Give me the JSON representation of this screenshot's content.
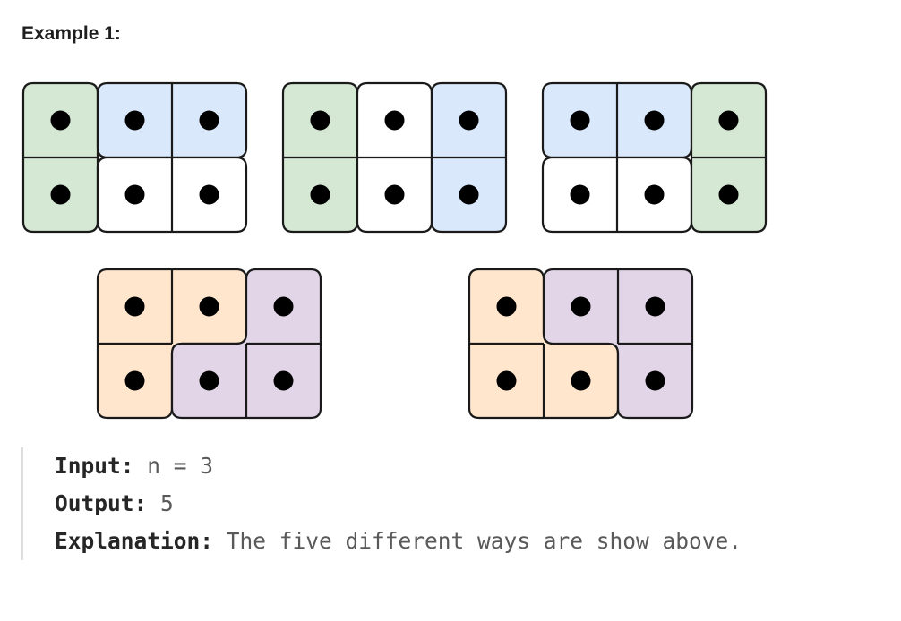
{
  "heading": "Example 1:",
  "colors": {
    "green": "#d5e8d4",
    "blue": "#dae8fc",
    "white": "#ffffff",
    "orange": "#ffe6cc",
    "purple": "#e1d5e7",
    "stroke": "#1a1a1a",
    "dot": "#000000"
  },
  "tilings": [
    {
      "pieces": [
        {
          "cells": [
            [
              0,
              0
            ],
            [
              1,
              0
            ]
          ],
          "color": "green"
        },
        {
          "cells": [
            [
              0,
              1
            ],
            [
              0,
              2
            ]
          ],
          "color": "blue"
        },
        {
          "cells": [
            [
              1,
              1
            ],
            [
              1,
              2
            ]
          ],
          "color": "white"
        }
      ]
    },
    {
      "pieces": [
        {
          "cells": [
            [
              0,
              0
            ],
            [
              1,
              0
            ]
          ],
          "color": "green"
        },
        {
          "cells": [
            [
              0,
              1
            ],
            [
              1,
              1
            ]
          ],
          "color": "white"
        },
        {
          "cells": [
            [
              0,
              2
            ],
            [
              1,
              2
            ]
          ],
          "color": "blue"
        }
      ]
    },
    {
      "pieces": [
        {
          "cells": [
            [
              0,
              0
            ],
            [
              0,
              1
            ]
          ],
          "color": "blue"
        },
        {
          "cells": [
            [
              1,
              0
            ],
            [
              1,
              1
            ]
          ],
          "color": "white"
        },
        {
          "cells": [
            [
              0,
              2
            ],
            [
              1,
              2
            ]
          ],
          "color": "green"
        }
      ]
    },
    {
      "pieces": [
        {
          "cells": [
            [
              0,
              0
            ],
            [
              0,
              1
            ],
            [
              1,
              0
            ]
          ],
          "color": "orange"
        },
        {
          "cells": [
            [
              0,
              2
            ],
            [
              1,
              1
            ],
            [
              1,
              2
            ]
          ],
          "color": "purple"
        }
      ]
    },
    {
      "pieces": [
        {
          "cells": [
            [
              0,
              0
            ],
            [
              1,
              0
            ],
            [
              1,
              1
            ]
          ],
          "color": "orange"
        },
        {
          "cells": [
            [
              0,
              1
            ],
            [
              0,
              2
            ],
            [
              1,
              2
            ]
          ],
          "color": "purple"
        }
      ]
    }
  ],
  "io": {
    "input_label": "Input:",
    "input_value": "n = 3",
    "output_label": "Output:",
    "output_value": "5",
    "explanation_label": "Explanation:",
    "explanation_value": "The five different ways are show above."
  }
}
